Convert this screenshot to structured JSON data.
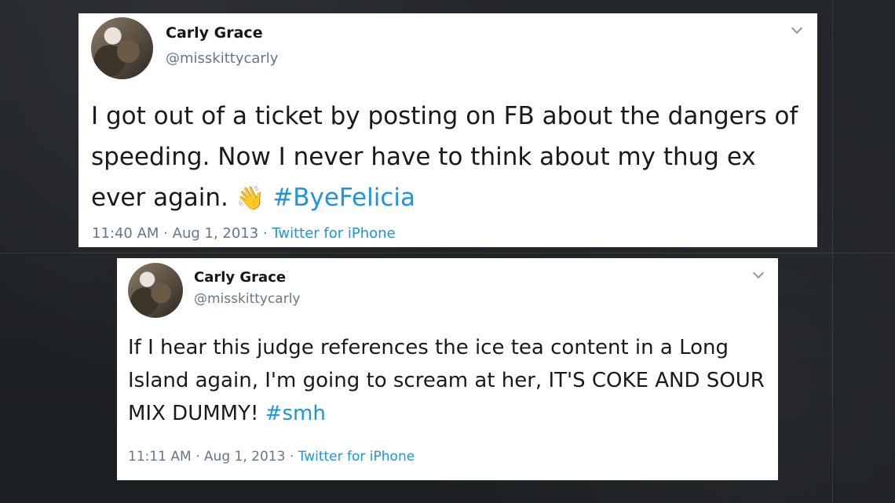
{
  "tweets": [
    {
      "name": "Carly Grace",
      "handle": "@misskittycarly",
      "text": "I got out of a ticket by posting on FB about the dangers of speeding. Now I never have to think about my thug ex ever again.",
      "emoji": "👋",
      "hashtag": "#ByeFelicia",
      "time": "11:40 AM",
      "date": "Aug 1, 2013",
      "source": "Twitter for iPhone"
    },
    {
      "name": "Carly Grace",
      "handle": "@misskittycarly",
      "text": "If I hear this judge references the ice tea content in a Long Island again, I'm going to scream at her, IT'S COKE AND SOUR MIX DUMMY!",
      "hashtag": "#smh",
      "time": "11:11 AM",
      "date": "Aug 1, 2013",
      "source": "Twitter for iPhone"
    }
  ],
  "separator": " · ",
  "colors": {
    "link": "#1b95e0",
    "muted": "#657786",
    "background": "#1f2226"
  }
}
